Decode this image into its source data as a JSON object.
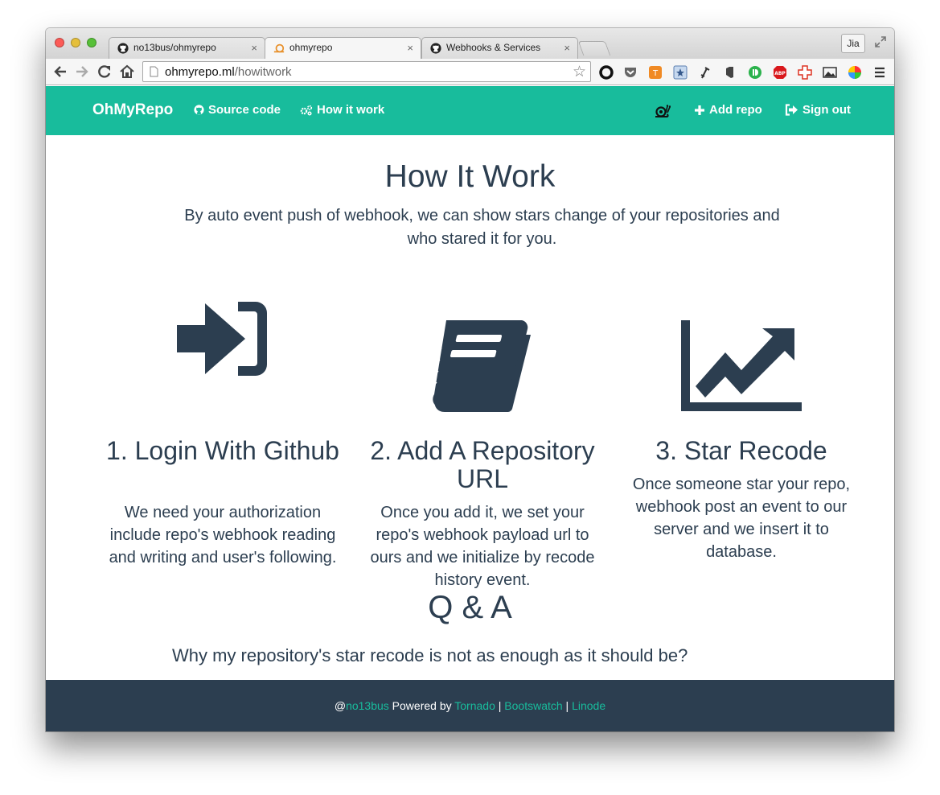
{
  "browser": {
    "tabs": [
      {
        "label": "no13bus/ohmyrepo"
      },
      {
        "label": "ohmyrepo"
      },
      {
        "label": "Webhooks & Services"
      }
    ],
    "profile_label": "Jia",
    "url_host": "ohmyrepo.ml",
    "url_path": "/howitwork"
  },
  "navbar": {
    "brand": "OhMyRepo",
    "source_code": "Source code",
    "how_it_work": "How it work",
    "add_repo": "Add repo",
    "sign_out": "Sign out"
  },
  "content": {
    "title": "How It Work",
    "lead": "By auto event push of webhook, we can show stars change of your repositories and who stared it for you.",
    "features": [
      {
        "icon": "sign-in-icon",
        "title": "1. Login With Github",
        "desc": "We need your authorization include repo's webhook reading and writing and user's following."
      },
      {
        "icon": "book-icon",
        "title": "2. Add A Repository URL",
        "desc": "Once you add it, we set your repo's webhook payload url to ours and we initialize by recode history event."
      },
      {
        "icon": "line-chart-icon",
        "title": "3. Star Recode",
        "desc": "Once someone star your repo, webhook post an event to our server and we insert it to database."
      }
    ],
    "qa_title": "Q & A",
    "qa_question": "Why my repository's star recode is not as enough as it should be?"
  },
  "footer": {
    "at": "@",
    "author": "no13bus",
    "powered_by": " Powered by ",
    "tornado": "Tornado",
    "sep": " | ",
    "bootswatch": "Bootswatch",
    "linode": "Linode"
  },
  "colors": {
    "navbar": "#18bc9c",
    "text": "#2c3e50",
    "footer": "#2c3e50",
    "link": "#18bc9c"
  }
}
